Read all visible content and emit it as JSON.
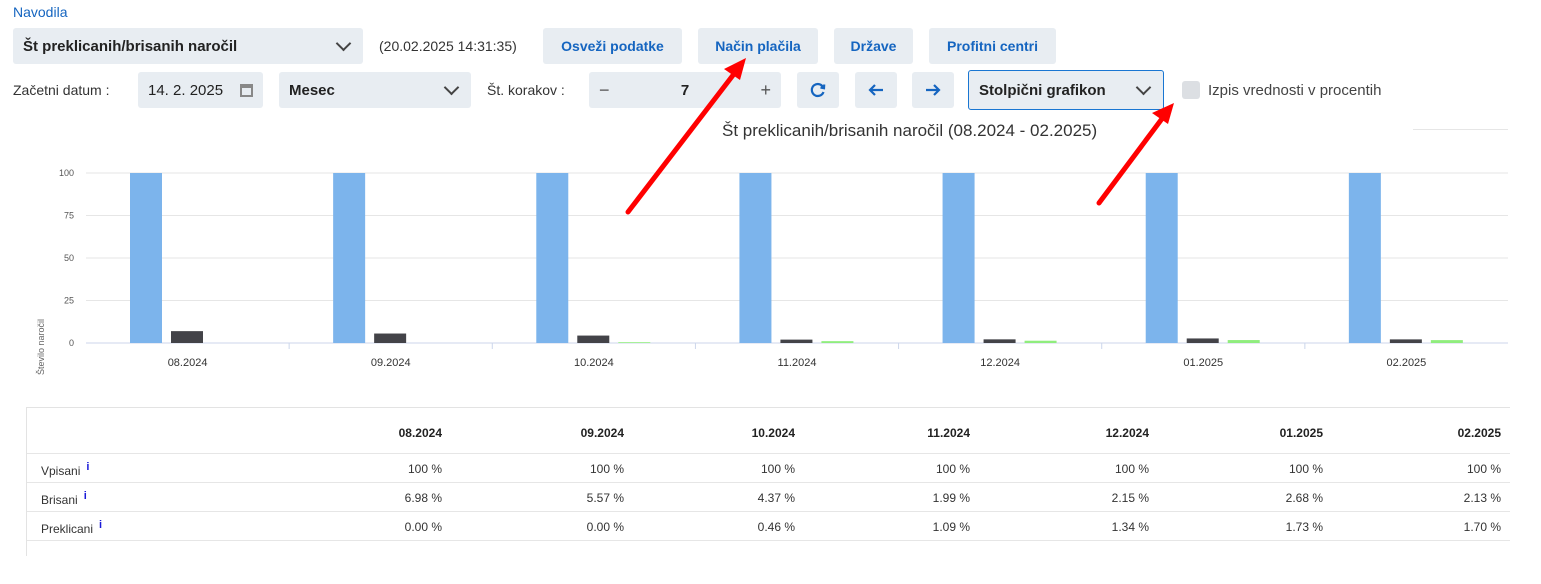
{
  "top": {
    "help_link": "Navodila",
    "report_select": "Št preklicanih/brisanih naročil",
    "timestamp": "(20.02.2025 14:31:35)",
    "refresh_button": "Osveži podatke",
    "payment_button": "Način plačila",
    "countries_button": "Države",
    "profit_button": "Profitni centri"
  },
  "controls": {
    "start_label": "Začetni datum :",
    "start_date": "14. 2. 2025",
    "period_select": "Mesec",
    "steps_label": "Št. korakov :",
    "steps_minus": "−",
    "steps_value": "7",
    "steps_plus": "+",
    "chart_type_select": "Stolpični grafikon",
    "percent_checkbox_label": "Izpis vrednosti v procentih",
    "percent_checked": false
  },
  "chart_data": {
    "type": "bar",
    "title": "Št preklicanih/brisanih naročil (08.2024 - 02.2025)",
    "ylabel": "Število naročil",
    "xlabel": "",
    "ylim": [
      0,
      100
    ],
    "yticks": [
      "0",
      "25",
      "50",
      "75",
      "100"
    ],
    "categories": [
      "08.2024",
      "09.2024",
      "10.2024",
      "11.2024",
      "12.2024",
      "01.2025",
      "02.2025"
    ],
    "series": [
      {
        "name": "Vpisani",
        "color": "#7cb4ec",
        "values": [
          100,
          100,
          100,
          100,
          100,
          100,
          100
        ]
      },
      {
        "name": "Brisani",
        "color": "#434348",
        "values": [
          6.98,
          5.57,
          4.37,
          1.99,
          2.15,
          2.68,
          2.13
        ]
      },
      {
        "name": "Preklicani",
        "color": "#90ed7d",
        "values": [
          0.0,
          0.0,
          0.46,
          1.09,
          1.34,
          1.73,
          1.7
        ]
      }
    ],
    "grid": true,
    "legend": "none"
  },
  "table": {
    "columns": [
      "08.2024",
      "09.2024",
      "10.2024",
      "11.2024",
      "12.2024",
      "01.2025",
      "02.2025"
    ],
    "rows": [
      {
        "label": "Vpisani",
        "info": "i",
        "values": [
          "100 %",
          "100 %",
          "100 %",
          "100 %",
          "100 %",
          "100 %",
          "100 %"
        ]
      },
      {
        "label": "Brisani",
        "info": "i",
        "values": [
          "6.98 %",
          "5.57 %",
          "4.37 %",
          "1.99 %",
          "2.15 %",
          "2.68 %",
          "2.13 %"
        ]
      },
      {
        "label": "Preklicani",
        "info": "i",
        "values": [
          "0.00 %",
          "0.00 %",
          "0.46 %",
          "1.09 %",
          "1.34 %",
          "1.73 %",
          "1.70 %"
        ]
      }
    ]
  },
  "colors": {
    "accent": "#1565c0",
    "control_bg": "#e8edf2",
    "annotation_arrow": "#ff0000"
  }
}
